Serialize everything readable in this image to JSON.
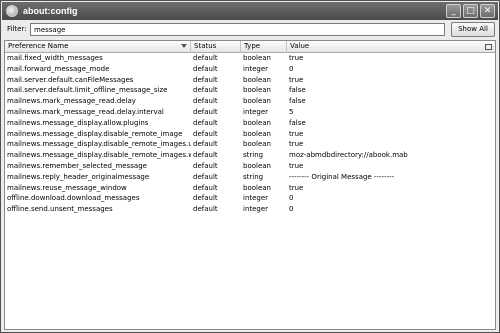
{
  "window": {
    "title": "about:config",
    "buttons": [
      "_",
      "□",
      "✕"
    ]
  },
  "filter": {
    "label": "Filter:",
    "value": "message",
    "show_all_label": "Show All"
  },
  "table": {
    "columns": [
      "Preference Name",
      "Status",
      "Type",
      "Value"
    ],
    "rows": [
      {
        "name": "mail.fixed_width_messages",
        "status": "default",
        "type": "boolean",
        "value": "true"
      },
      {
        "name": "mail.forward_message_mode",
        "status": "default",
        "type": "integer",
        "value": "0"
      },
      {
        "name": "mail.server.default.canFileMessages",
        "status": "default",
        "type": "boolean",
        "value": "true"
      },
      {
        "name": "mail.server.default.limit_offline_message_size",
        "status": "default",
        "type": "boolean",
        "value": "false"
      },
      {
        "name": "mailnews.mark_message_read.delay",
        "status": "default",
        "type": "boolean",
        "value": "false"
      },
      {
        "name": "mailnews.mark_message_read.delay.interval",
        "status": "default",
        "type": "integer",
        "value": "5"
      },
      {
        "name": "mailnews.message_display.allow.plugins",
        "status": "default",
        "type": "boolean",
        "value": "false"
      },
      {
        "name": "mailnews.message_display.disable_remote_image",
        "status": "default",
        "type": "boolean",
        "value": "true"
      },
      {
        "name": "mailnews.message_display.disable_remote_images.us...",
        "status": "default",
        "type": "boolean",
        "value": "true"
      },
      {
        "name": "mailnews.message_display.disable_remote_images.wh...",
        "status": "default",
        "type": "string",
        "value": "moz-abmdbdirectory://abook.mab"
      },
      {
        "name": "mailnews.remember_selected_message",
        "status": "default",
        "type": "boolean",
        "value": "true"
      },
      {
        "name": "mailnews.reply_header_originalmessage",
        "status": "default",
        "type": "string",
        "value": "-------- Original Message --------"
      },
      {
        "name": "mailnews.reuse_message_window",
        "status": "default",
        "type": "boolean",
        "value": "true"
      },
      {
        "name": "offline.download.download_messages",
        "status": "default",
        "type": "integer",
        "value": "0"
      },
      {
        "name": "offline.send.unsent_messages",
        "status": "default",
        "type": "integer",
        "value": "0"
      }
    ]
  }
}
